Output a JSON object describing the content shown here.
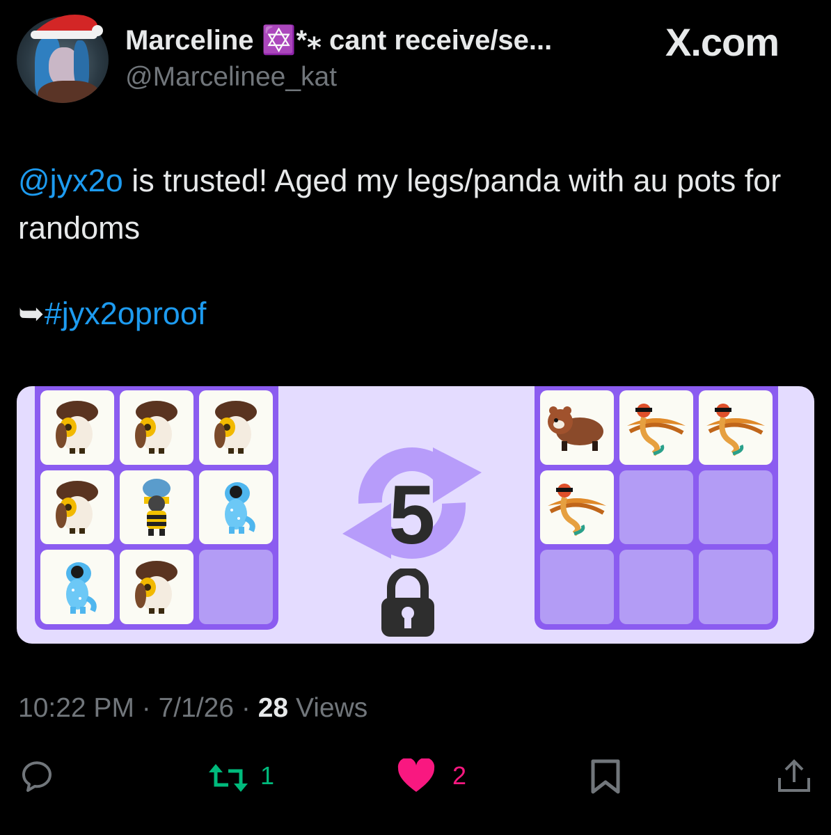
{
  "header": {
    "display_name": "Marceline ✡️*⁎ cant receive/se...",
    "handle": "@Marcelinee_kat",
    "brand": "X.com"
  },
  "tweet": {
    "mention": "@jyx2o",
    "text_after_mention": " is trusted! Aged my legs/panda with au pots for randoms",
    "arrow": "➥",
    "hashtag": "#jyx2oproof"
  },
  "trade": {
    "counter_value": "5",
    "left_slots": [
      "owl",
      "owl",
      "owl",
      "owl",
      "bee",
      "dino",
      "dino",
      "owl",
      "empty"
    ],
    "right_slots": [
      "red-panda",
      "quetzal",
      "quetzal",
      "quetzal",
      "empty",
      "empty",
      "empty",
      "empty",
      "empty"
    ]
  },
  "meta": {
    "time": "10:22 PM",
    "sep1": " · ",
    "date": "7/1/26",
    "sep2": " · ",
    "views_count": "28",
    "views_label": " Views"
  },
  "actions": {
    "reply_count": "",
    "retweet_count": "1",
    "like_count": "2"
  },
  "colors": {
    "accent": "#1d9bf0",
    "retweet": "#00ba7c",
    "like": "#f91880",
    "muted": "#71767b",
    "grid_purple": "#8b5cf0"
  }
}
